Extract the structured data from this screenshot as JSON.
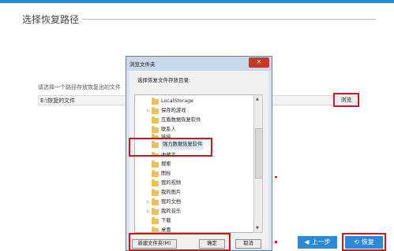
{
  "main": {
    "section_title": "选择恢复路径",
    "path_prompt": "请选择一个路径存放恢复出的文件",
    "path_value": "E:\\恢复的文件",
    "browse_label": "浏览",
    "back_label": "上一步",
    "restore_label": "恢复"
  },
  "dialog": {
    "title": "浏览文件夹",
    "close_symbol": "✕",
    "prompt": "选择恢复文件存放目录:",
    "new_folder_label": "新建文件夹(M)",
    "ok_label": "确定",
    "cancel_label": "取消",
    "tree_items": [
      {
        "label": "LocalStorage",
        "caret": ""
      },
      {
        "label": "保存的游戏",
        "caret": "▷"
      },
      {
        "label": "互盾数据恢复软件",
        "caret": ""
      },
      {
        "label": "联系人",
        "caret": ""
      },
      {
        "label": "链接",
        "caret": ""
      },
      {
        "label": "强力数据恢复软件",
        "caret": "",
        "selected": true
      },
      {
        "label": "收藏夹",
        "caret": ""
      },
      {
        "label": "搜索",
        "caret": ""
      },
      {
        "label": "图标",
        "caret": ""
      },
      {
        "label": "我的视频",
        "caret": ""
      },
      {
        "label": "我的图片",
        "caret": ""
      },
      {
        "label": "我的文档",
        "caret": "▷"
      },
      {
        "label": "我的音乐",
        "caret": "▷"
      },
      {
        "label": "下载",
        "caret": ""
      },
      {
        "label": "桌面",
        "caret": ""
      }
    ]
  },
  "colors": {
    "accent": "#2b8ad6",
    "highlight": "#d0161c",
    "folder": "#e8c062"
  },
  "icons": {
    "scroll_up": "▲",
    "scroll_down": "▼",
    "back": "◀",
    "restore": "⟲"
  }
}
